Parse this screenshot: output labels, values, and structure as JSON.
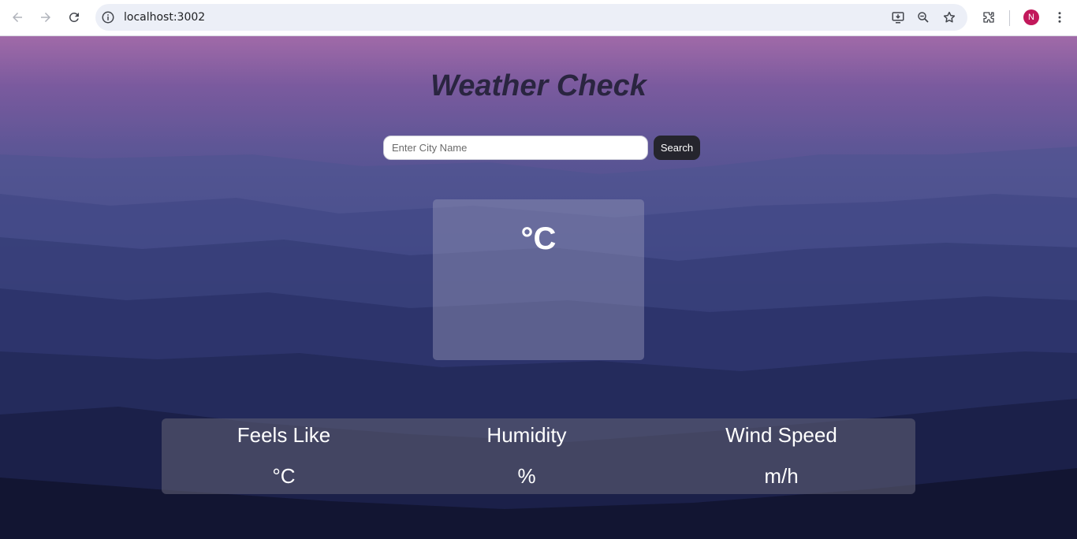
{
  "browser": {
    "url": "localhost:3002",
    "profile_initial": "N",
    "icons": [
      "back-icon",
      "forward-icon",
      "reload-icon",
      "site-info-icon",
      "install-app-icon",
      "zoom-icon",
      "bookmark-star-icon",
      "extensions-icon",
      "menu-icon"
    ]
  },
  "app": {
    "title": "Weather Check",
    "search": {
      "placeholder": "Enter City Name",
      "value": "",
      "button_label": "Search"
    },
    "temperature": {
      "value": "°C"
    },
    "details": [
      {
        "label": "Feels Like",
        "value": "°C"
      },
      {
        "label": "Humidity",
        "value": "%"
      },
      {
        "label": "Wind Speed",
        "value": "m/h"
      }
    ]
  },
  "colors": {
    "avatar": "#c2185b",
    "search_button": "#25252d",
    "title_text": "#2a2540"
  }
}
